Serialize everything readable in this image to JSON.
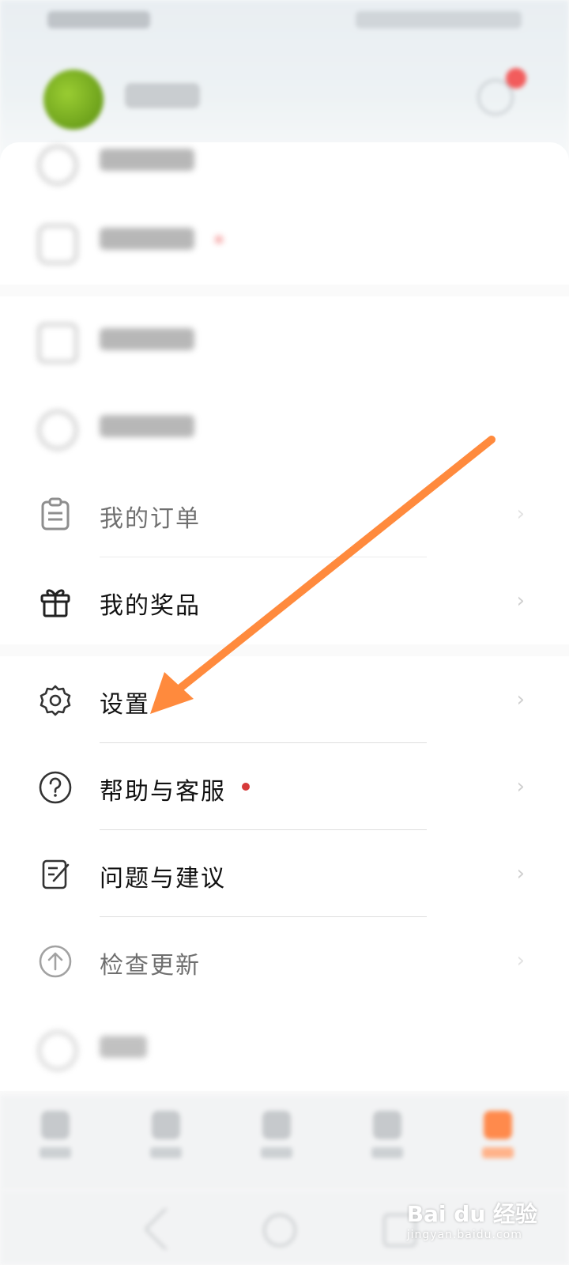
{
  "menu": {
    "orders": "我的订单",
    "prizes": "我的奖品",
    "settings": "设置",
    "help": "帮助与客服",
    "feedback": "问题与建议",
    "update": "检查更新"
  },
  "watermark": {
    "brand": "Bai du 经验",
    "url": "jingyan.baidu.com"
  },
  "colors": {
    "accent": "#ff8a3d",
    "badge": "#d63a3a"
  }
}
